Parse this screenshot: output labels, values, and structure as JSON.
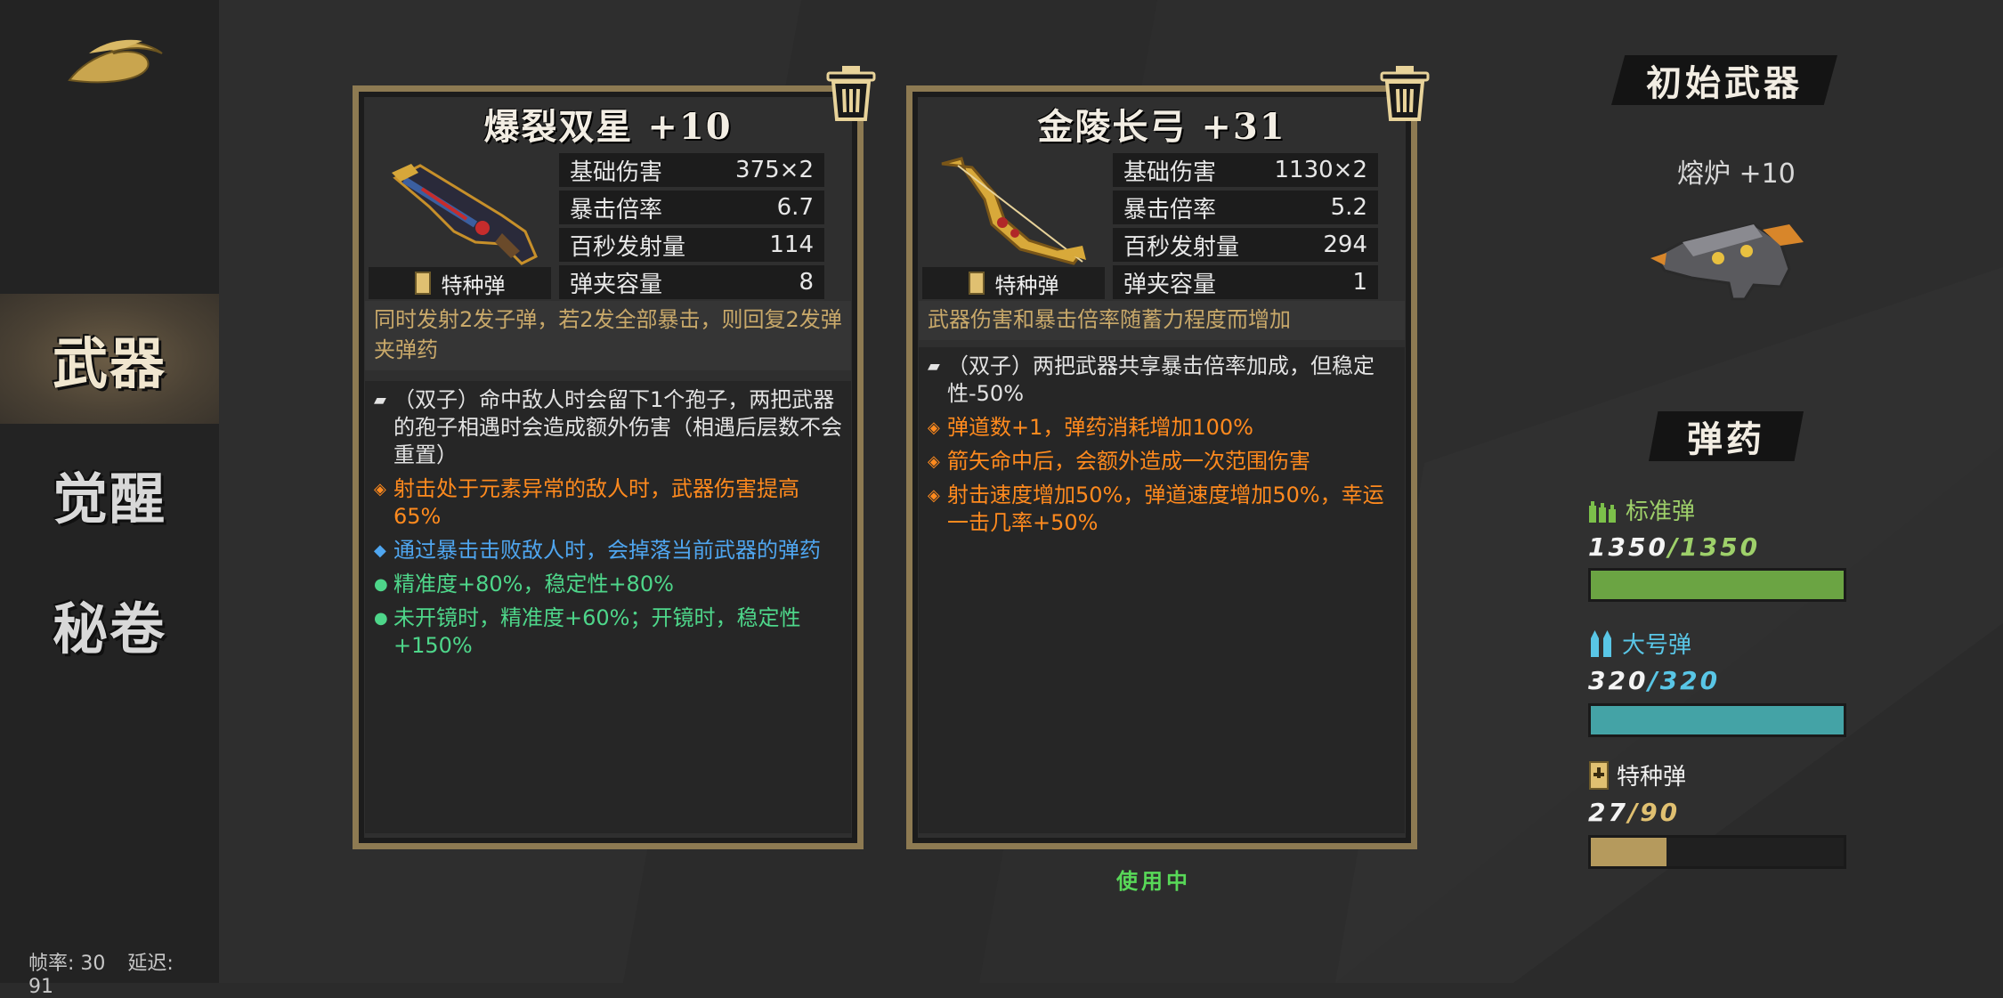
{
  "sidebar": {
    "nav": [
      {
        "label": "武器",
        "active": true
      },
      {
        "label": "觉醒",
        "active": false
      },
      {
        "label": "秘卷",
        "active": false
      }
    ]
  },
  "status": {
    "fps": "帧率: 30",
    "latency": "延迟: 91"
  },
  "weapons": [
    {
      "name": "爆裂双星 +10",
      "ammo_type": "特种弹",
      "stats": [
        {
          "label": "基础伤害",
          "value": "375×2"
        },
        {
          "label": "暴击倍率",
          "value": "6.7"
        },
        {
          "label": "百秒发射量",
          "value": "114"
        },
        {
          "label": "弹夹容量",
          "value": "8"
        }
      ],
      "description": "同时发射2发子弹，若2发全部暴击，则回复2发弹夹弹药",
      "perks": [
        {
          "style": "grey",
          "text": "（双子）命中敌人时会留下1个孢子，两把武器的孢子相遇时会造成额外伤害（相遇后层数不会重置）"
        },
        {
          "style": "orange",
          "text": "射击处于元素异常的敌人时，武器伤害提高65%"
        },
        {
          "style": "blue",
          "text": "通过暴击击败敌人时，会掉落当前武器的弹药"
        },
        {
          "style": "green",
          "text": "精准度+80%，稳定性+80%"
        },
        {
          "style": "green",
          "text": "未开镜时，精准度+60%；开镜时，稳定性+150%"
        }
      ]
    },
    {
      "name": "金陵长弓 +31",
      "ammo_type": "特种弹",
      "stats": [
        {
          "label": "基础伤害",
          "value": "1130×2"
        },
        {
          "label": "暴击倍率",
          "value": "5.2"
        },
        {
          "label": "百秒发射量",
          "value": "294"
        },
        {
          "label": "弹夹容量",
          "value": "1"
        }
      ],
      "description": "武器伤害和暴击倍率随蓄力程度而增加",
      "perks": [
        {
          "style": "grey",
          "text": "（双子）两把武器共享暴击倍率加成，但稳定性-50%"
        },
        {
          "style": "orange",
          "text": "弹道数+1，弹药消耗增加100%"
        },
        {
          "style": "orange",
          "text": "箭矢命中后，会额外造成一次范围伤害"
        },
        {
          "style": "orange",
          "text": "射击速度增加50%，弹道速度增加50%，幸运一击几率+50%"
        }
      ],
      "in_use": "使用中"
    }
  ],
  "initial_weapon": {
    "title": "初始武器",
    "name": "熔炉 +10"
  },
  "ammo": {
    "title": "弹药",
    "items": [
      {
        "label": "标准弹",
        "current": "1350",
        "max": "1350",
        "fraction": 1.0,
        "color": "#6ba443",
        "count_color": "#9ed06a"
      },
      {
        "label": "大号弹",
        "current": "320",
        "max": "320",
        "fraction": 1.0,
        "color": "#44a3a6",
        "count_color": "#59c6e6"
      },
      {
        "label": "特种弹",
        "current": "27",
        "max": "90",
        "fraction": 0.3,
        "color": "#b59a5d",
        "count_color": "#e0c071"
      }
    ]
  }
}
